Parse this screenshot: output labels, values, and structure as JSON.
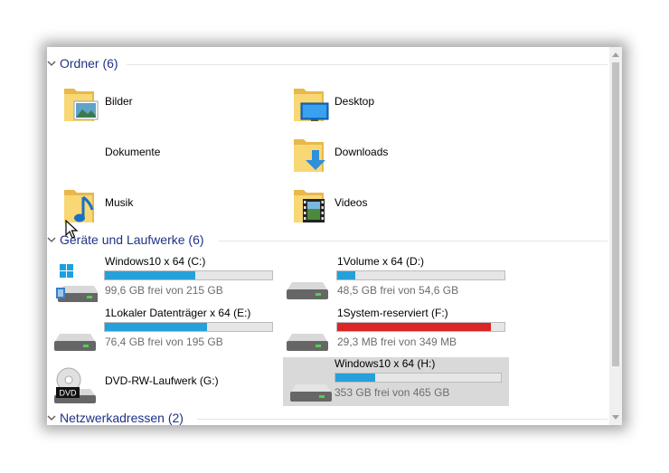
{
  "groups": {
    "folders": {
      "title": "Ordner (6)"
    },
    "devices": {
      "title": "Geräte und Laufwerke (6)"
    },
    "network": {
      "title": "Netzwerkadressen (2)"
    }
  },
  "folders": [
    {
      "label": "Bilder",
      "icon": "pictures-folder-icon"
    },
    {
      "label": "Desktop",
      "icon": "desktop-folder-icon"
    },
    {
      "label": "Dokumente",
      "icon": "documents-folder-icon"
    },
    {
      "label": "Downloads",
      "icon": "downloads-folder-icon"
    },
    {
      "label": "Musik",
      "icon": "music-folder-icon"
    },
    {
      "label": "Videos",
      "icon": "videos-folder-icon"
    }
  ],
  "drives": [
    {
      "label": "Windows10 x 64 (C:)",
      "free": "99,6 GB frei von 215 GB",
      "used_fraction": 0.54,
      "color": "#26a0da",
      "icon": "system-drive-icon"
    },
    {
      "label": "1Volume x 64 (D:)",
      "free": "48,5 GB frei von 54,6 GB",
      "used_fraction": 0.11,
      "color": "#26a0da",
      "icon": "hard-drive-icon"
    },
    {
      "label": "1Lokaler Datenträger x 64 (E:)",
      "free": "76,4 GB frei von 195 GB",
      "used_fraction": 0.61,
      "color": "#26a0da",
      "icon": "hard-drive-icon"
    },
    {
      "label": "1System-reserviert (F:)",
      "free": "29,3 MB frei von 349 MB",
      "used_fraction": 0.92,
      "color": "#da2626",
      "icon": "hard-drive-icon"
    },
    {
      "label": "DVD-RW-Laufwerk (G:)",
      "icon": "dvd-drive-icon"
    },
    {
      "label": "Windows10 x 64 (H:)",
      "free": "353 GB frei von 465 GB",
      "used_fraction": 0.24,
      "color": "#26a0da",
      "icon": "hard-drive-icon",
      "selected": true
    }
  ],
  "dvd_badge": "DVD"
}
